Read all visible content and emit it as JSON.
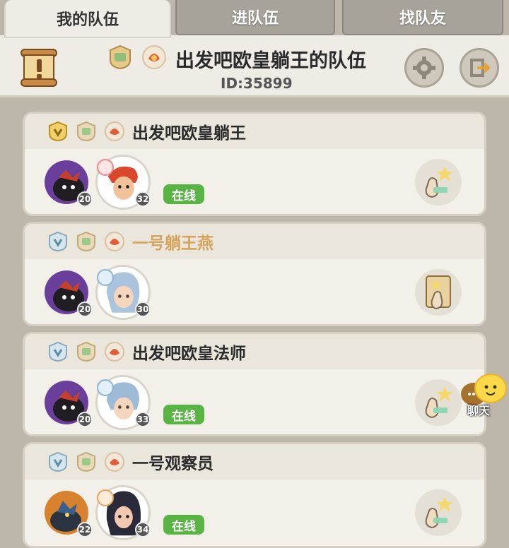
{
  "tabs": [
    {
      "label": "我的队伍",
      "active": true
    },
    {
      "label": "进队伍",
      "active": false
    },
    {
      "label": "找队友",
      "active": false
    }
  ],
  "header": {
    "team_name": "出发吧欧皇躺王的队伍",
    "team_id": "ID:35899"
  },
  "members": [
    {
      "name": "出发吧欧皇躺王",
      "name_color": "#2a2a2a",
      "pet_level": "20",
      "hero_level": "32",
      "status": "在线",
      "rank_badge": "gold"
    },
    {
      "name": "一号躺王燕",
      "name_color": "#d4a35c",
      "pet_level": "20",
      "hero_level": "30",
      "status": "",
      "rank_badge": "silver"
    },
    {
      "name": "出发吧欧皇法师",
      "name_color": "#2a2a2a",
      "pet_level": "20",
      "hero_level": "33",
      "status": "在线",
      "rank_badge": "silver"
    },
    {
      "name": "一号观察员",
      "name_color": "#2a2a2a",
      "pet_level": "22",
      "hero_level": "34",
      "status": "在线",
      "rank_badge": "silver"
    }
  ],
  "chat": {
    "label": "聊天"
  },
  "colors": {
    "online": "#59b543",
    "background": "#bdb6ab",
    "card": "#f3f0ea"
  }
}
